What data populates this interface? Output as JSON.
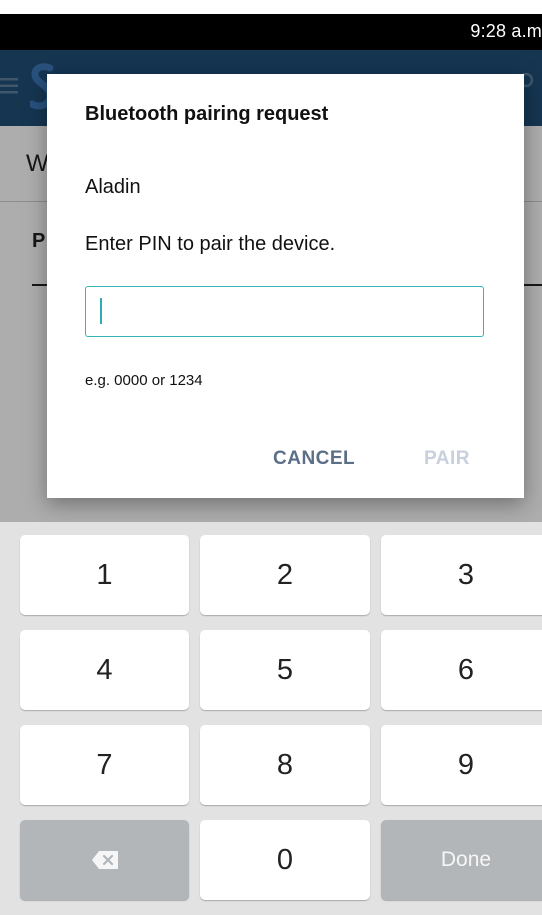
{
  "status_bar": {
    "time": "9:28 a.m"
  },
  "page": {
    "heading": "W",
    "tab_label": "P"
  },
  "dialog": {
    "title": "Bluetooth pairing request",
    "device_name": "Aladin",
    "instruction": "Enter PIN to pair the device.",
    "pin_value": "",
    "hint": "e.g. 0000 or 1234",
    "cancel_label": "CANCEL",
    "pair_label": "PAIR"
  },
  "keyboard": {
    "keys": {
      "k1": "1",
      "k2": "2",
      "k3": "3",
      "k4": "4",
      "k5": "5",
      "k6": "6",
      "k7": "7",
      "k8": "8",
      "k9": "9",
      "k0": "0",
      "done": "Done"
    },
    "backspace_icon": "backspace-icon"
  },
  "colors": {
    "app_bar": "#1f4e78",
    "accent": "#35b4b8",
    "cancel_text": "#5b6f86",
    "pair_disabled_text": "#c7d0dc",
    "keyboard_bg": "#e2e2e2",
    "function_key": "#b3b6b9"
  }
}
